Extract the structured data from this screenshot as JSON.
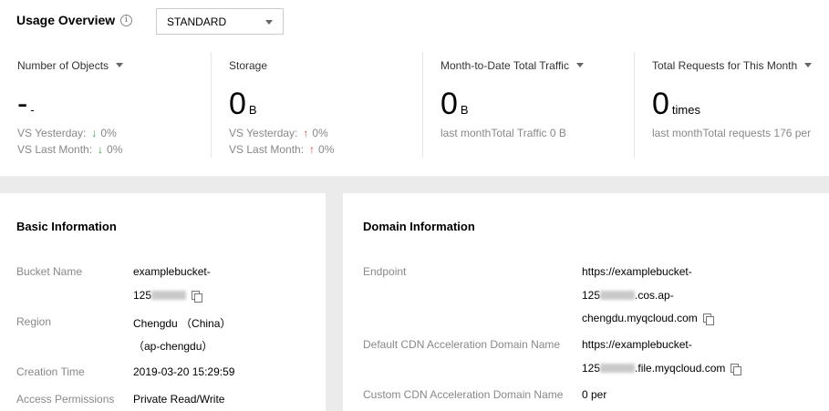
{
  "overview": {
    "title": "Usage Overview",
    "info_icon": "i",
    "storage_class": "STANDARD"
  },
  "metrics": [
    {
      "label": "Number of Objects",
      "value": "-",
      "unit": "-",
      "yesterday_label": "VS Yesterday:",
      "yesterday_trend": "down",
      "yesterday_value": "0%",
      "lastmonth_label": "VS Last Month:",
      "lastmonth_trend": "down",
      "lastmonth_value": "0%"
    },
    {
      "label": "Storage",
      "value": "0",
      "unit": "B",
      "yesterday_label": "VS Yesterday:",
      "yesterday_trend": "up",
      "yesterday_value": "0%",
      "lastmonth_label": "VS Last Month:",
      "lastmonth_trend": "up",
      "lastmonth_value": "0%"
    },
    {
      "label": "Month-to-Date Total Traffic",
      "value": "0",
      "unit": "B",
      "note": "last monthTotal Traffic 0 B"
    },
    {
      "label": "Total Requests for This Month",
      "value": "0",
      "unit": "times",
      "note": "last monthTotal requests 176 per"
    }
  ],
  "arrows": {
    "up": "↑",
    "down": "↓"
  },
  "basic": {
    "title": "Basic Information",
    "bucket_name_label": "Bucket Name",
    "bucket_name_line1": "examplebucket-",
    "bucket_name_line2_prefix": "125",
    "bucket_name_line2_suffix": "",
    "region_label": "Region",
    "region_line1": "Chengdu （China）",
    "region_line2": "（ap-chengdu）",
    "creation_label": "Creation Time",
    "creation_value": "2019-03-20 15:29:59",
    "access_label": "Access Permissions",
    "access_value": "Private Read/Write"
  },
  "domain": {
    "title": "Domain Information",
    "endpoint_label": "Endpoint",
    "endpoint_line1": "https://examplebucket-",
    "endpoint_line2_prefix": "125",
    "endpoint_line2_suffix": ".cos.ap-",
    "endpoint_line3": "chengdu.myqcloud.com",
    "cdn_default_label": "Default CDN Acceleration Domain Name",
    "cdn_default_line1": "https://examplebucket-",
    "cdn_default_line2_prefix": "125",
    "cdn_default_line2_suffix": ".file.myqcloud.com",
    "cdn_custom_label": "Custom CDN Acceleration Domain Name",
    "cdn_custom_value": "0 per"
  }
}
